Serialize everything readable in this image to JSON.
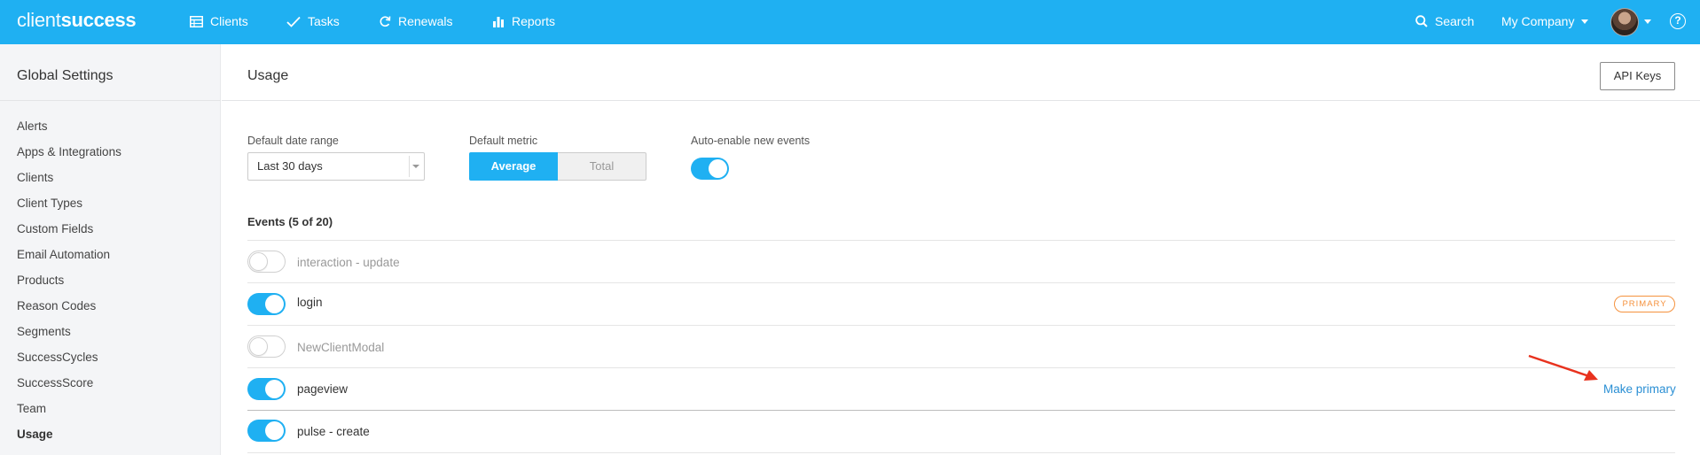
{
  "nav": {
    "logo_thin": "client",
    "logo_bold": "success",
    "items": [
      {
        "label": "Clients",
        "icon": "table-icon"
      },
      {
        "label": "Tasks",
        "icon": "check-icon"
      },
      {
        "label": "Renewals",
        "icon": "refresh-icon"
      },
      {
        "label": "Reports",
        "icon": "bar-chart-icon"
      }
    ],
    "search_label": "Search",
    "company_label": "My Company",
    "help_glyph": "?",
    "accent_color": "#1fb0f2"
  },
  "sidebar": {
    "title": "Global Settings",
    "items": [
      {
        "label": "Alerts"
      },
      {
        "label": "Apps & Integrations"
      },
      {
        "label": "Clients"
      },
      {
        "label": "Client Types"
      },
      {
        "label": "Custom Fields"
      },
      {
        "label": "Email Automation"
      },
      {
        "label": "Products"
      },
      {
        "label": "Reason Codes"
      },
      {
        "label": "Segments"
      },
      {
        "label": "SuccessCycles"
      },
      {
        "label": "SuccessScore"
      },
      {
        "label": "Team"
      },
      {
        "label": "Usage",
        "active": true
      }
    ]
  },
  "main": {
    "title": "Usage",
    "api_button": "API Keys",
    "date_range": {
      "label": "Default date range",
      "value": "Last 30 days"
    },
    "metric": {
      "label": "Default metric",
      "options": [
        "Average",
        "Total"
      ],
      "selected": "Average"
    },
    "auto_enable": {
      "label": "Auto-enable new events",
      "enabled": true
    },
    "events": {
      "title": "Events (5 of 20)",
      "rows": [
        {
          "name": "interaction - update",
          "enabled": false
        },
        {
          "name": "login",
          "enabled": true,
          "badge": "PRIMARY"
        },
        {
          "name": "NewClientModal",
          "enabled": false
        },
        {
          "name": "pageview",
          "enabled": true,
          "action": "Make primary"
        },
        {
          "name": "pulse - create",
          "enabled": true
        }
      ]
    },
    "badge_color": "#f5923e",
    "link_color": "#2a8fd4",
    "annotation_arrow_color": "#e8321e"
  }
}
